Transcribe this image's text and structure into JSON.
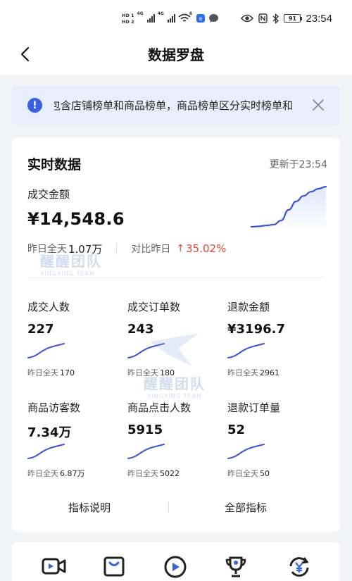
{
  "status_bar": {
    "hd1": "HD 1",
    "hd2": "HD 2",
    "net1": "4G",
    "net2": "4G",
    "wifi_badge": "6",
    "battery": "91",
    "time": "23:54"
  },
  "nav": {
    "title": "数据罗盘"
  },
  "notice": {
    "text": "包含店铺榜单和商品榜单，商品榜单区分实时榜单和"
  },
  "realtime": {
    "title": "实时数据",
    "update_time": "更新于23:54",
    "gmv_label": "成交金额",
    "gmv_value": "¥14,548.6",
    "yesterday_label": "昨日全天",
    "yesterday_value": "1.07万",
    "compare_label": "对比昨日",
    "compare_arrow": "↑",
    "compare_value": "35.02%",
    "gmv_trend": [
      0.05,
      0.06,
      0.08,
      0.1,
      0.2,
      0.45,
      0.65,
      0.78,
      0.88,
      0.95,
      1.0
    ]
  },
  "metrics": [
    {
      "label": "成交人数",
      "value": "227",
      "prev_label": "昨日全天",
      "prev_value": "170"
    },
    {
      "label": "成交订单数",
      "value": "243",
      "prev_label": "昨日全天",
      "prev_value": "180"
    },
    {
      "label": "退款金额",
      "value": "¥3196.7",
      "prev_label": "昨日全天",
      "prev_value": "2961"
    },
    {
      "label": "商品访客数",
      "value": "7.34万",
      "prev_label": "昨日全天",
      "prev_value": "6.87万"
    },
    {
      "label": "商品点击人数",
      "value": "5915",
      "prev_label": "昨日全天",
      "prev_value": "5022"
    },
    {
      "label": "退款订单量",
      "value": "52",
      "prev_label": "昨日全天",
      "prev_value": "50"
    }
  ],
  "footer": {
    "indicator_help": "指标说明",
    "all_indicators": "全部指标"
  },
  "watermark": {
    "text": "醒醒团队",
    "sub": "XINGXING TEAM"
  },
  "tools": [
    {
      "icon": "video-camera-icon"
    },
    {
      "icon": "shopping-bag-icon"
    },
    {
      "icon": "play-circle-icon"
    },
    {
      "icon": "trophy-icon"
    },
    {
      "icon": "refund-cycle-icon"
    }
  ],
  "colors": {
    "accent": "#3a5fe0",
    "up": "#e5453a",
    "notice_bg": "#e8eefb"
  }
}
